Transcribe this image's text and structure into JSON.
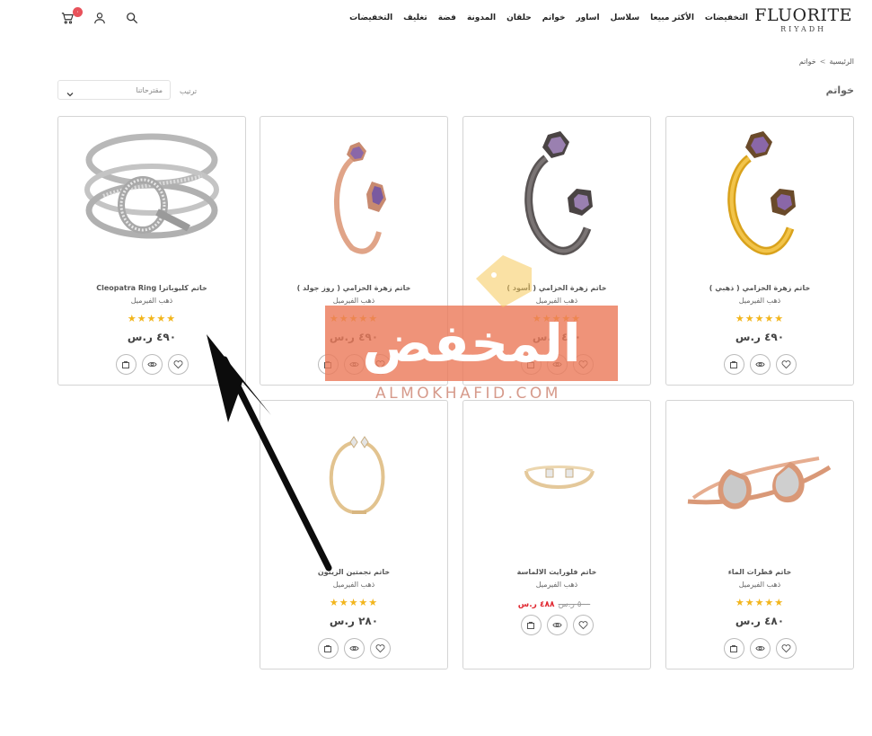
{
  "brand": {
    "name": "FLUORITE",
    "city": "RIYADH"
  },
  "menu": [
    "التخفيضات",
    "الأكثر مبيعا",
    "سلاسل",
    "اساور",
    "خواتم",
    "حلقان",
    "المدونة",
    "فضة",
    "تغليف",
    "التخفيضات"
  ],
  "cart": {
    "count": "٠"
  },
  "breadcrumb": {
    "home": "الرئيسية",
    "sep": ">",
    "current": "خواتم"
  },
  "page_title": "خواتم",
  "sort": {
    "label": "ترتيب",
    "value": "مقترحاتنا"
  },
  "products": [
    {
      "name": "خاتم زهرة الخزامي ( ذهبي )",
      "category": "ذهب الفيرميل",
      "stars": "★★★★★",
      "price": "٤٩٠ ر.س",
      "sale": "",
      "old": ""
    },
    {
      "name": "خاتم زهرة الخزامي ( أسود )",
      "category": "ذهب الفيرميل",
      "stars": "★★★★★",
      "price": "٤٩٠ ر.س",
      "sale": "",
      "old": ""
    },
    {
      "name": "خاتم زهرة الخزامي ( روز جولد )",
      "category": "ذهب الفيرميل",
      "stars": "★★★★★",
      "price": "٤٩٠ ر.س",
      "sale": "",
      "old": ""
    },
    {
      "name": "Cleopatra Ring خاتم كليوباترا",
      "category": "ذهب الفيرميل",
      "stars": "★★★★★",
      "price": "٤٩٠ ر.س",
      "sale": "",
      "old": ""
    },
    {
      "name": "خاتم قطرات الماء",
      "category": "ذهب الفيرميل",
      "stars": "★★★★★",
      "price": "٤٨٠ ر.س",
      "sale": "",
      "old": ""
    },
    {
      "name": "خاتم فلورايت الالماسة",
      "category": "ذهب الفيرميل",
      "stars": "",
      "price": "",
      "sale": "٤٨٨ ر.س",
      "old": "٥٠٠ ر.س"
    },
    {
      "name": "خاتم نجمتين الزيتون",
      "category": "ذهب الفيرميل",
      "stars": "★★★★★",
      "price": "٢٨٠ ر.س",
      "sale": "",
      "old": ""
    }
  ],
  "watermark": {
    "text": "المخفض",
    "url": "ALMOKHAFID.COM"
  },
  "colors": {
    "accent": "#e8525b",
    "stars": "#f2b51c",
    "sale": "#e0262f",
    "watermark": "#ec7b5c"
  }
}
